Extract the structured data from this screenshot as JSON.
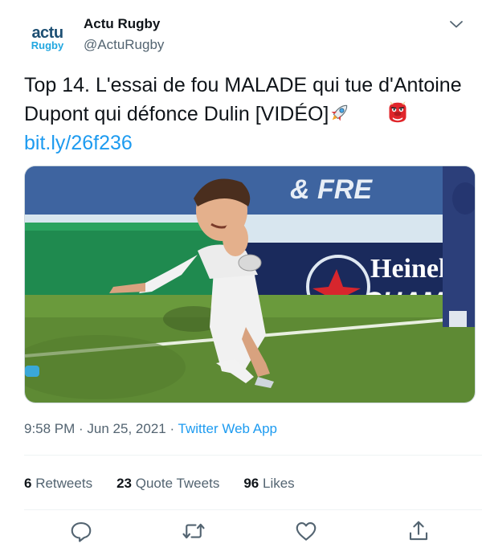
{
  "account": {
    "avatar_top": "actu",
    "avatar_bottom": "Rugby",
    "display_name": "Actu Rugby",
    "handle": "@ActuRugby"
  },
  "tweet": {
    "text_main": "Top 14. L'essai de fou MALADE qui tue d'Antoine Dupont qui défonce Dulin [VIDÉO]",
    "link": "bit.ly/26f236",
    "emojis": [
      "rocket-emoji",
      "goblin-emoji"
    ]
  },
  "media": {
    "banner_text": "& FRE",
    "sponsor_text_1": "Heinel",
    "sponsor_text_2": "CHAM"
  },
  "meta": {
    "time": "9:58 PM",
    "date": "Jun 25, 2021",
    "separator": " · ",
    "source": "Twitter Web App"
  },
  "stats": {
    "retweets_count": "6",
    "retweets_label": "Retweets",
    "quotes_count": "23",
    "quotes_label": "Quote Tweets",
    "likes_count": "96",
    "likes_label": "Likes"
  },
  "actions": [
    "reply-icon",
    "retweet-icon",
    "like-icon",
    "share-icon"
  ],
  "colors": {
    "link": "#1d9bf0",
    "secondary_text": "#536471",
    "primary_text": "#0f1419"
  }
}
